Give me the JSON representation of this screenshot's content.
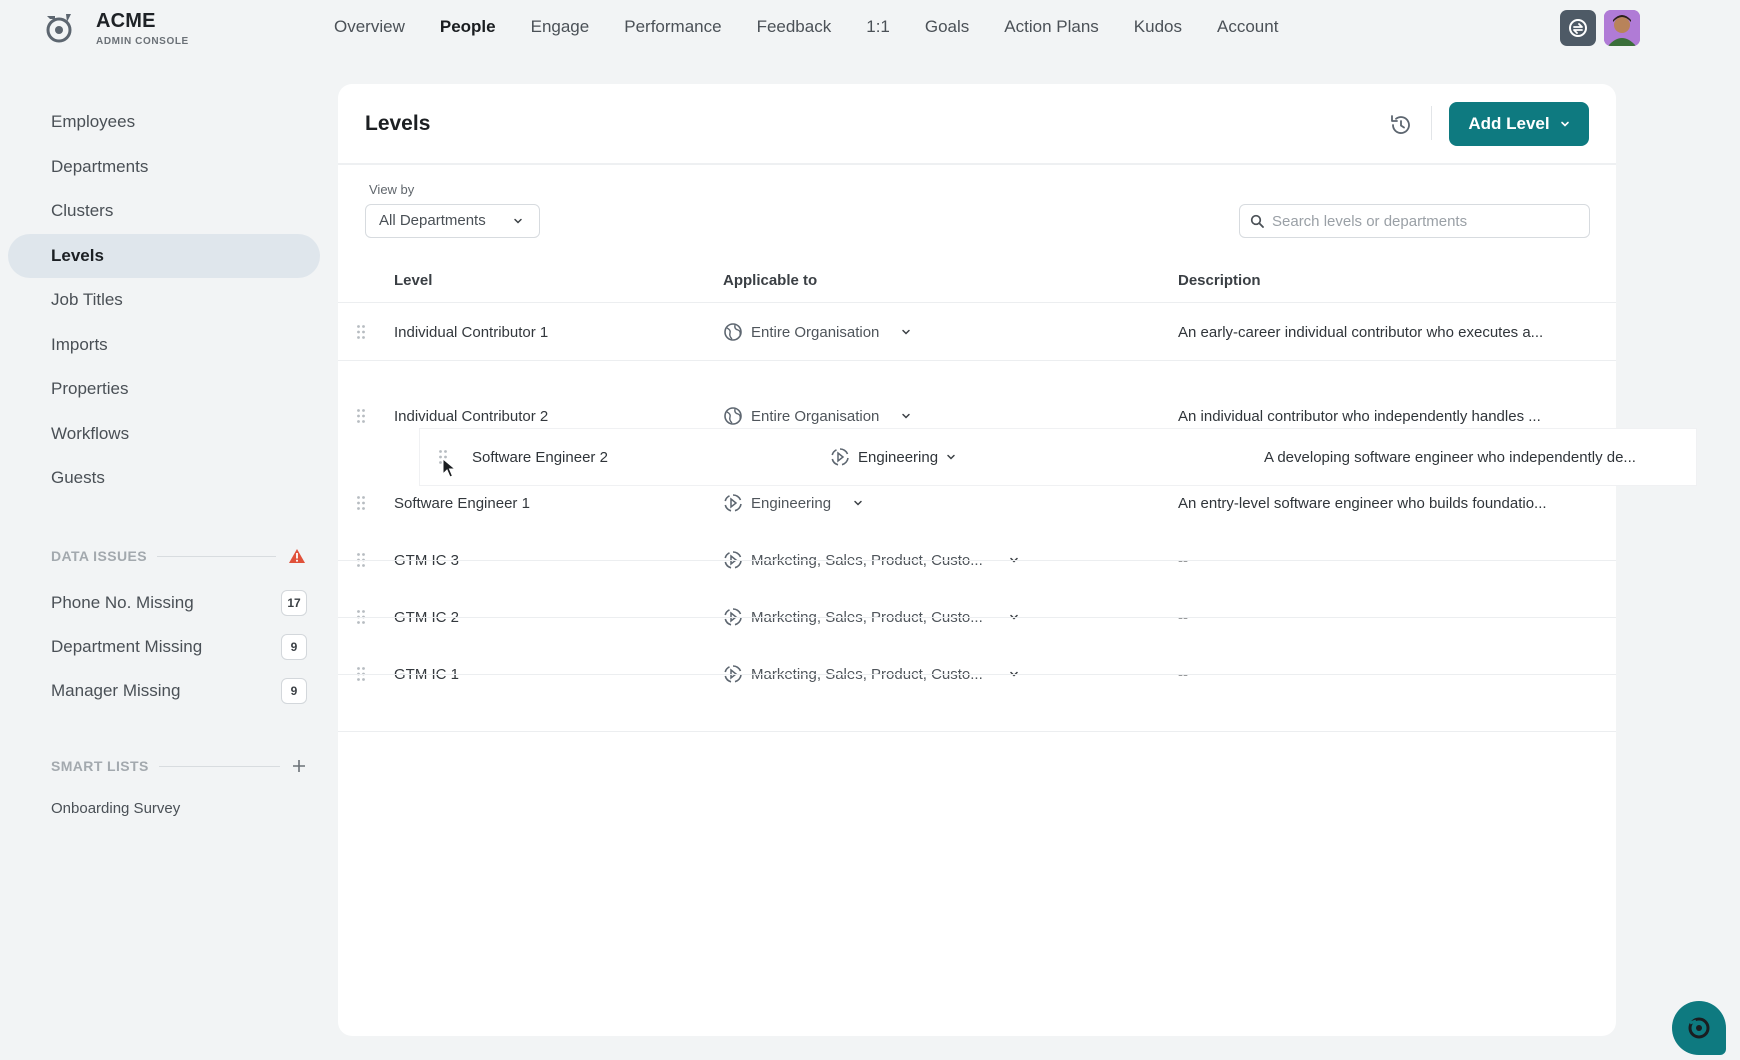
{
  "brand": {
    "name": "ACME",
    "subtitle": "ADMIN CONSOLE"
  },
  "nav": [
    {
      "label": "Overview",
      "active": false
    },
    {
      "label": "People",
      "active": true
    },
    {
      "label": "Engage",
      "active": false
    },
    {
      "label": "Performance",
      "active": false
    },
    {
      "label": "Feedback",
      "active": false
    },
    {
      "label": "1:1",
      "active": false
    },
    {
      "label": "Goals",
      "active": false
    },
    {
      "label": "Action Plans",
      "active": false
    },
    {
      "label": "Kudos",
      "active": false
    },
    {
      "label": "Account",
      "active": false
    }
  ],
  "sidebar": {
    "items": [
      {
        "label": "Employees"
      },
      {
        "label": "Departments"
      },
      {
        "label": "Clusters"
      },
      {
        "label": "Levels",
        "active": true
      },
      {
        "label": "Job Titles"
      },
      {
        "label": "Imports"
      },
      {
        "label": "Properties"
      },
      {
        "label": "Workflows"
      },
      {
        "label": "Guests"
      }
    ],
    "data_issues": {
      "heading": "DATA ISSUES",
      "items": [
        {
          "label": "Phone No. Missing",
          "count": "17"
        },
        {
          "label": "Department Missing",
          "count": "9"
        },
        {
          "label": "Manager Missing",
          "count": "9"
        }
      ]
    },
    "smart_lists": {
      "heading": "SMART LISTS",
      "items": [
        {
          "label": "Onboarding Survey"
        }
      ]
    }
  },
  "main": {
    "title": "Levels",
    "add_button": "Add Level",
    "view_by_label": "View by",
    "view_by_value": "All Departments",
    "search_placeholder": "Search levels or departments",
    "columns": {
      "level": "Level",
      "applicable": "Applicable to",
      "description": "Description"
    },
    "rows": [
      {
        "level": "Individual Contributor 1",
        "applicable": "Entire Organisation",
        "scope": "org",
        "description": "An early-career individual contributor who executes a..."
      },
      {
        "level": "Individual Contributor 2",
        "applicable": "Entire Organisation",
        "scope": "org",
        "description": "An individual contributor who independently handles ..."
      },
      {
        "level": "Software Engineer 1",
        "applicable": "Engineering",
        "scope": "dept",
        "description": "An entry-level software engineer who builds foundatio..."
      },
      {
        "level": "GTM IC 3",
        "applicable": "Marketing, Sales, Product, Custo...",
        "scope": "dept",
        "description": "--"
      },
      {
        "level": "GTM IC 2",
        "applicable": "Marketing, Sales, Product, Custo...",
        "scope": "dept",
        "description": "--"
      },
      {
        "level": "GTM IC 1",
        "applicable": "Marketing, Sales, Product, Custo...",
        "scope": "dept",
        "description": "--"
      }
    ],
    "dragging_row": {
      "level": "Software Engineer 2",
      "applicable": "Engineering",
      "scope": "dept",
      "description": "A developing software engineer who independently de..."
    }
  },
  "colors": {
    "accent": "#0e7a80",
    "warning": "#e0513a",
    "active_bg": "#dfe6ec"
  }
}
